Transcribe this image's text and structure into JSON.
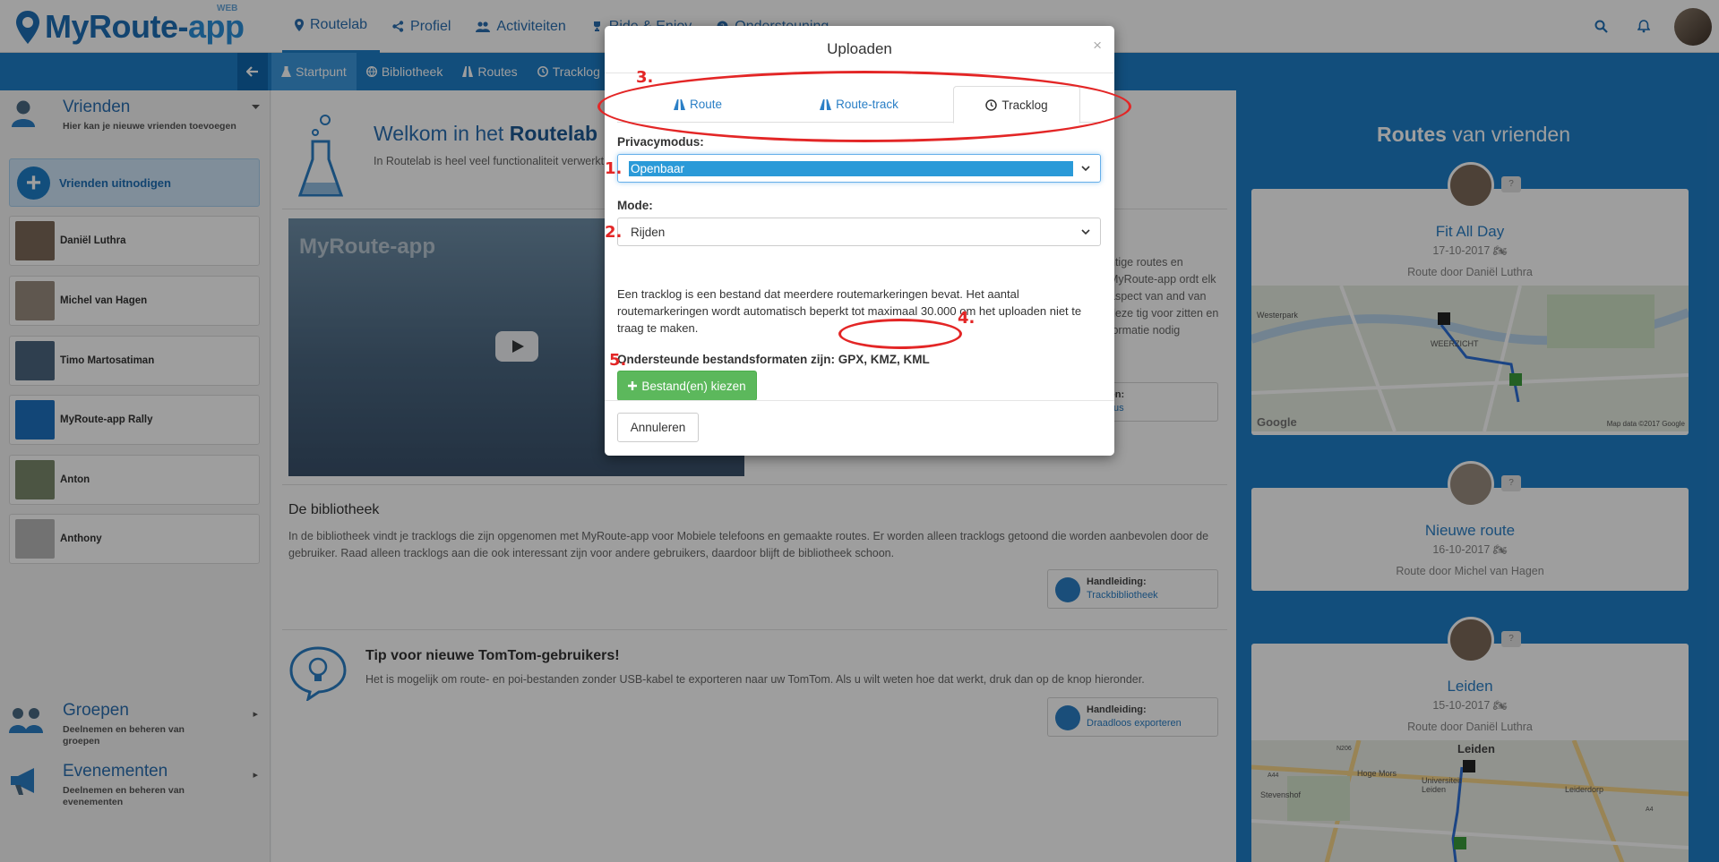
{
  "app": {
    "logo_main": "MyRoute-",
    "logo_accent": "app",
    "logo_badge": "WEB"
  },
  "topnav": {
    "items": [
      {
        "label": "Routelab",
        "icon": "map-pin-icon",
        "active": true
      },
      {
        "label": "Profiel",
        "icon": "share-icon"
      },
      {
        "label": "Activiteiten",
        "icon": "users-icon"
      },
      {
        "label": "Ride & Enjoy",
        "icon": "trophy-icon"
      },
      {
        "label": "Ondersteuning",
        "icon": "help-icon"
      }
    ]
  },
  "subnav": {
    "tabs": [
      {
        "label": "Startpunt",
        "icon": "flask-icon",
        "active": true
      },
      {
        "label": "Bibliotheek",
        "icon": "globe-icon"
      },
      {
        "label": "Routes",
        "icon": "road-icon"
      },
      {
        "label": "Tracklog",
        "icon": "clock-icon"
      }
    ]
  },
  "sidebar": {
    "friends_title": "Vrienden",
    "friends_subtitle": "Hier kan je nieuwe vrienden toevoegen",
    "invite_label": "Vrienden uitnodigen",
    "friends": [
      {
        "name": "Daniël Luthra",
        "color": "#7d6a59"
      },
      {
        "name": "Michel van Hagen",
        "color": "#9a8d80"
      },
      {
        "name": "Timo Martosatiman",
        "color": "#4d6680"
      },
      {
        "name": "MyRoute-app Rally",
        "color": "#1d72c0"
      },
      {
        "name": "Anton",
        "color": "#7b8a6d"
      },
      {
        "name": "Anthony",
        "color": "#b8b8b8"
      }
    ],
    "groups": {
      "title": "Groepen",
      "subtitle": "Deelnemen en beheren van groepen"
    },
    "events": {
      "title": "Evenementen",
      "subtitle": "Deelnemen en beheren van evenementen"
    }
  },
  "main": {
    "welcome_prefix": "Welkom in het ",
    "welcome_bold": "Routelab",
    "welcome_text": "In Routelab is heel veel functionaliteit verwerkt. ... andige informatie op een rijtje hebben gezet. De voorpret va...",
    "video_logo": "MyRoute-app",
    "right_text": "ntige routes en MyRoute-app ordt elk aspect van and van deze tig voor zitten en formatie nodig",
    "intro_handleiding_label": "meteen:",
    "intro_handleiding_link": "e cursus",
    "library_title": "De bibliotheek",
    "library_text": "In de bibliotheek vindt je tracklogs die zijn opgenomen met MyRoute-app voor Mobiele telefoons en gemaakte routes. Er worden alleen tracklogs getoond die worden aanbevolen door de gebruiker. Raad alleen tracklogs aan die ook interessant zijn voor andere gebruikers, daardoor blijft de bibliotheek schoon.",
    "library_handleiding_label": "Handleiding:",
    "library_handleiding_link": "Trackbibliotheek",
    "tip_title": "Tip voor nieuwe TomTom-gebruikers!",
    "tip_text": "Het is mogelijk om route- en poi-bestanden zonder USB-kabel te exporteren naar uw TomTom. Als u wilt weten hoe dat werkt, druk dan op de knop hieronder.",
    "tip_handleiding_label": "Handleiding:",
    "tip_handleiding_link": "Draadloos exporteren"
  },
  "right_panel": {
    "title_bold": "Routes",
    "title_rest": " van vrienden",
    "cards": [
      {
        "name": "Fit All Day",
        "date": "17-10-2017",
        "by": "Route door Daniël Luthra",
        "badge": "?",
        "map_labels": [
          "Westerpark",
          "WEERZICHT",
          "Google",
          "Map data ©2017 Google"
        ]
      },
      {
        "name": "Nieuwe route",
        "date": "16-10-2017",
        "by": "Route door Michel van Hagen",
        "badge": "?"
      },
      {
        "name": "Leiden",
        "date": "15-10-2017",
        "by": "Route door Daniël Luthra",
        "badge": "?",
        "map_labels": [
          "Leiden",
          "Hoge Mors",
          "Stevenshof",
          "Universiteit Leiden",
          "Leiderdorp",
          "N206",
          "A44",
          "A4"
        ]
      }
    ]
  },
  "modal": {
    "title": "Uploaden",
    "close": "×",
    "tabs": [
      {
        "label": "Route",
        "icon": "road-icon"
      },
      {
        "label": "Route-track",
        "icon": "road-icon"
      },
      {
        "label": "Tracklog",
        "icon": "clock-icon",
        "active": true
      }
    ],
    "privacy_label": "Privacymodus:",
    "privacy_value": "Openbaar",
    "mode_label": "Mode:",
    "mode_value": "Rijden",
    "info_text": "Een tracklog is een bestand dat meerdere routemarkeringen bevat. Het aantal routemarkeringen wordt automatisch beperkt tot maximaal 30.000 om het uploaden niet te traag te maken.",
    "formats_label": "Ondersteunde bestandsformaten zijn: ",
    "formats_value": "GPX, KMZ, KML",
    "choose_button": "Bestand(en) kiezen",
    "cancel_button": "Annuleren"
  },
  "annotations": {
    "color": "#e32626",
    "numbers": [
      "1.",
      "2.",
      "3.",
      "4.",
      "5."
    ]
  }
}
